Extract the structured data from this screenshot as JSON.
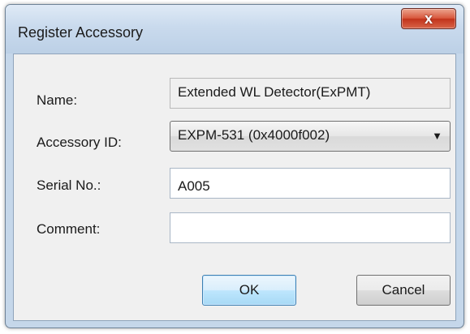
{
  "window": {
    "title": "Register Accessory",
    "close_glyph": "x"
  },
  "form": {
    "name_label": "Name:",
    "name_value": "Extended WL Detector(ExPMT)",
    "accessory_id_label": "Accessory ID:",
    "accessory_id_value": "EXPM-531 (0x4000f002)",
    "serial_label": "Serial No.:",
    "serial_value": "A005",
    "comment_label": "Comment:",
    "comment_value": ""
  },
  "buttons": {
    "ok_label": "OK",
    "cancel_label": "Cancel"
  },
  "icons": {
    "close": "close-icon",
    "dropdown": "chevron-down-icon"
  },
  "colors": {
    "frame": "#c5d7ea",
    "client": "#f0f0f0",
    "close_button": "#c9391f",
    "ok_border": "#3c7fb1"
  }
}
